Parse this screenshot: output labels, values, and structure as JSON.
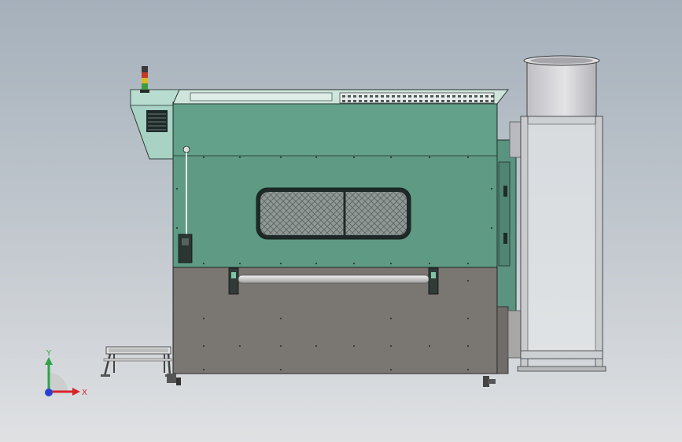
{
  "viewport": {
    "background_top": "#a5b0bb",
    "background_bottom": "#dfe1e3"
  },
  "machine": {
    "upper_panel_color": "#5e9a84",
    "lower_panel_color": "#7a7672",
    "control_box_color": "#a8d2c4",
    "window_mesh_color": "#8f9895",
    "duct_color": "#d2d2d5",
    "frame_color": "#c9cbcd"
  },
  "signal_tower": {
    "lights": [
      "#3a3a3a",
      "#c23a2a",
      "#d7b92c",
      "#3e9a42"
    ]
  },
  "triad": {
    "x_label": "X",
    "y_label": "Y",
    "x_color": "#d6242b",
    "y_color": "#2ea24a",
    "z_color": "#2b3fcf"
  }
}
